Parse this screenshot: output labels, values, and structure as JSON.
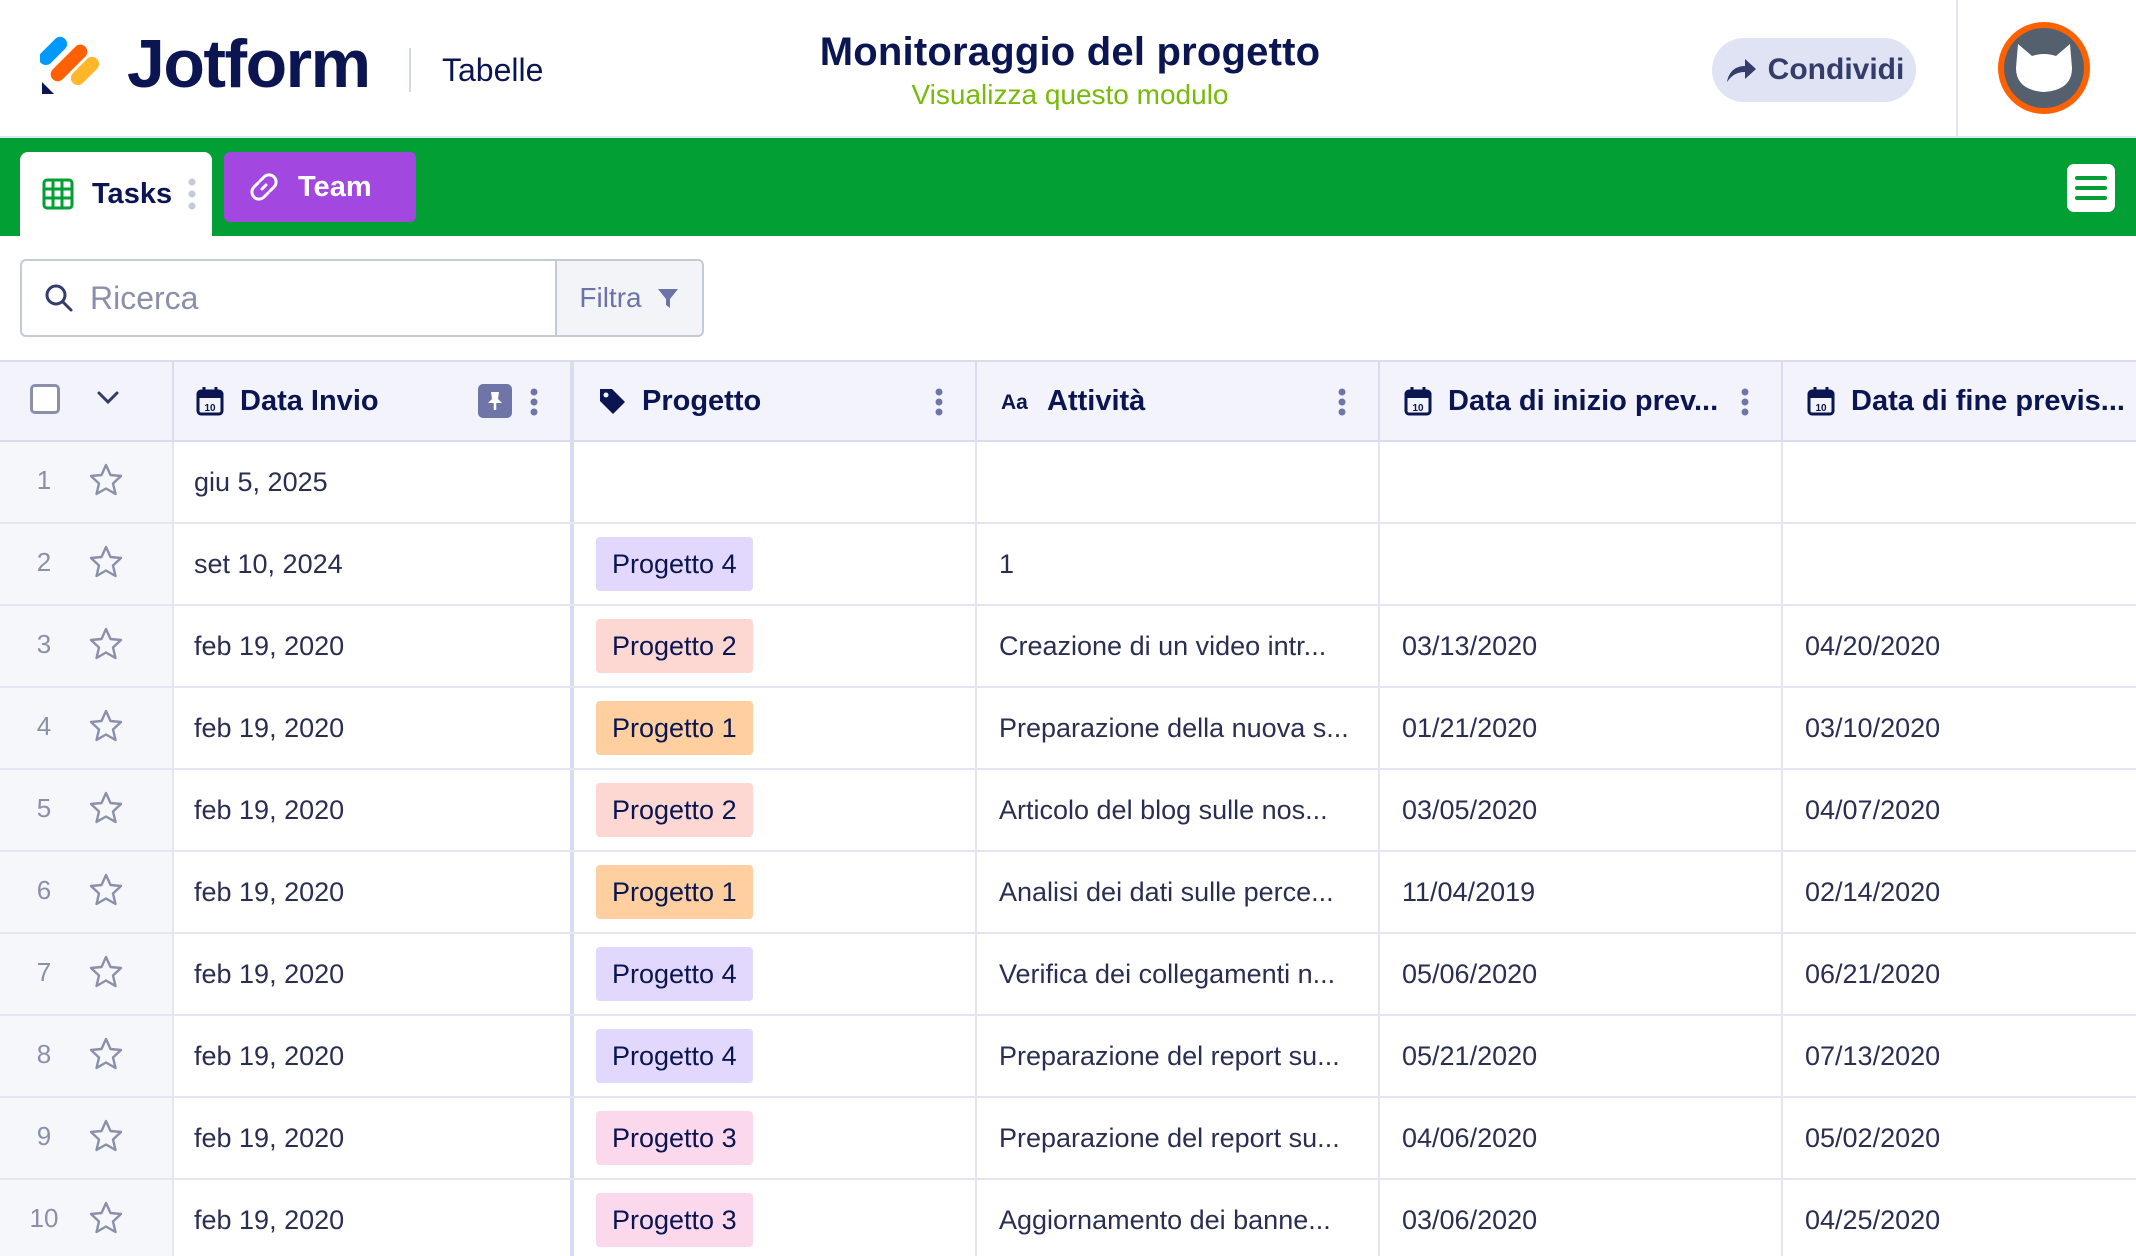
{
  "header": {
    "brand": "Jotform",
    "section": "Tabelle",
    "title": "Monitoraggio del progetto",
    "subtitle": "Visualizza questo modulo",
    "share_label": "Condividi",
    "avatar_icon": "cat-avatar-icon"
  },
  "tabs": [
    {
      "label": "Tasks",
      "icon": "grid-icon",
      "active": true
    },
    {
      "label": "Team",
      "icon": "link-icon",
      "color": "#a247e0"
    }
  ],
  "toolbar": {
    "search_placeholder": "Ricerca",
    "filter_label": "Filtra"
  },
  "colors": {
    "tabbar": "#029f35",
    "accent_green": "#78bb07",
    "navy": "#0a1551",
    "tag_purple": "#e2d8fd",
    "tag_red": "#fdd8d3",
    "tag_orange": "#ffcf9f",
    "tag_pink": "#fcd8ed"
  },
  "table": {
    "columns": [
      {
        "label": "Data Invio",
        "icon": "calendar-icon"
      },
      {
        "label": "Progetto",
        "icon": "tag-icon"
      },
      {
        "label": "Attività",
        "icon": "text-aa-icon"
      },
      {
        "label": "Data di inizio prev...",
        "icon": "calendar-icon"
      },
      {
        "label": "Data di fine previs...",
        "icon": "calendar-icon"
      }
    ],
    "rows": [
      {
        "n": "1",
        "date": "giu 5, 2025",
        "project": "",
        "tag_color": "",
        "task": "",
        "start": "",
        "end": ""
      },
      {
        "n": "2",
        "date": "set 10, 2024",
        "project": "Progetto 4",
        "tag_color": "#e2d8fd",
        "task": "1",
        "start": "",
        "end": ""
      },
      {
        "n": "3",
        "date": "feb 19, 2020",
        "project": "Progetto 2",
        "tag_color": "#fdd8d3",
        "task": "Creazione di un video intr...",
        "start": "03/13/2020",
        "end": "04/20/2020"
      },
      {
        "n": "4",
        "date": "feb 19, 2020",
        "project": "Progetto 1",
        "tag_color": "#ffcf9f",
        "task": "Preparazione della nuova s...",
        "start": "01/21/2020",
        "end": "03/10/2020"
      },
      {
        "n": "5",
        "date": "feb 19, 2020",
        "project": "Progetto 2",
        "tag_color": "#fdd8d3",
        "task": "Articolo del blog sulle nos...",
        "start": "03/05/2020",
        "end": "04/07/2020"
      },
      {
        "n": "6",
        "date": "feb 19, 2020",
        "project": "Progetto 1",
        "tag_color": "#ffcf9f",
        "task": "Analisi dei dati sulle perce...",
        "start": "11/04/2019",
        "end": "02/14/2020"
      },
      {
        "n": "7",
        "date": "feb 19, 2020",
        "project": "Progetto 4",
        "tag_color": "#e2d8fd",
        "task": "Verifica dei collegamenti n...",
        "start": "05/06/2020",
        "end": "06/21/2020"
      },
      {
        "n": "8",
        "date": "feb 19, 2020",
        "project": "Progetto 4",
        "tag_color": "#e2d8fd",
        "task": "Preparazione del report su...",
        "start": "05/21/2020",
        "end": "07/13/2020"
      },
      {
        "n": "9",
        "date": "feb 19, 2020",
        "project": "Progetto 3",
        "tag_color": "#fcd8ed",
        "task": "Preparazione del report su...",
        "start": "04/06/2020",
        "end": "05/02/2020"
      },
      {
        "n": "10",
        "date": "feb 19, 2020",
        "project": "Progetto 3",
        "tag_color": "#fcd8ed",
        "task": "Aggiornamento dei banne...",
        "start": "03/06/2020",
        "end": "04/25/2020"
      }
    ]
  }
}
